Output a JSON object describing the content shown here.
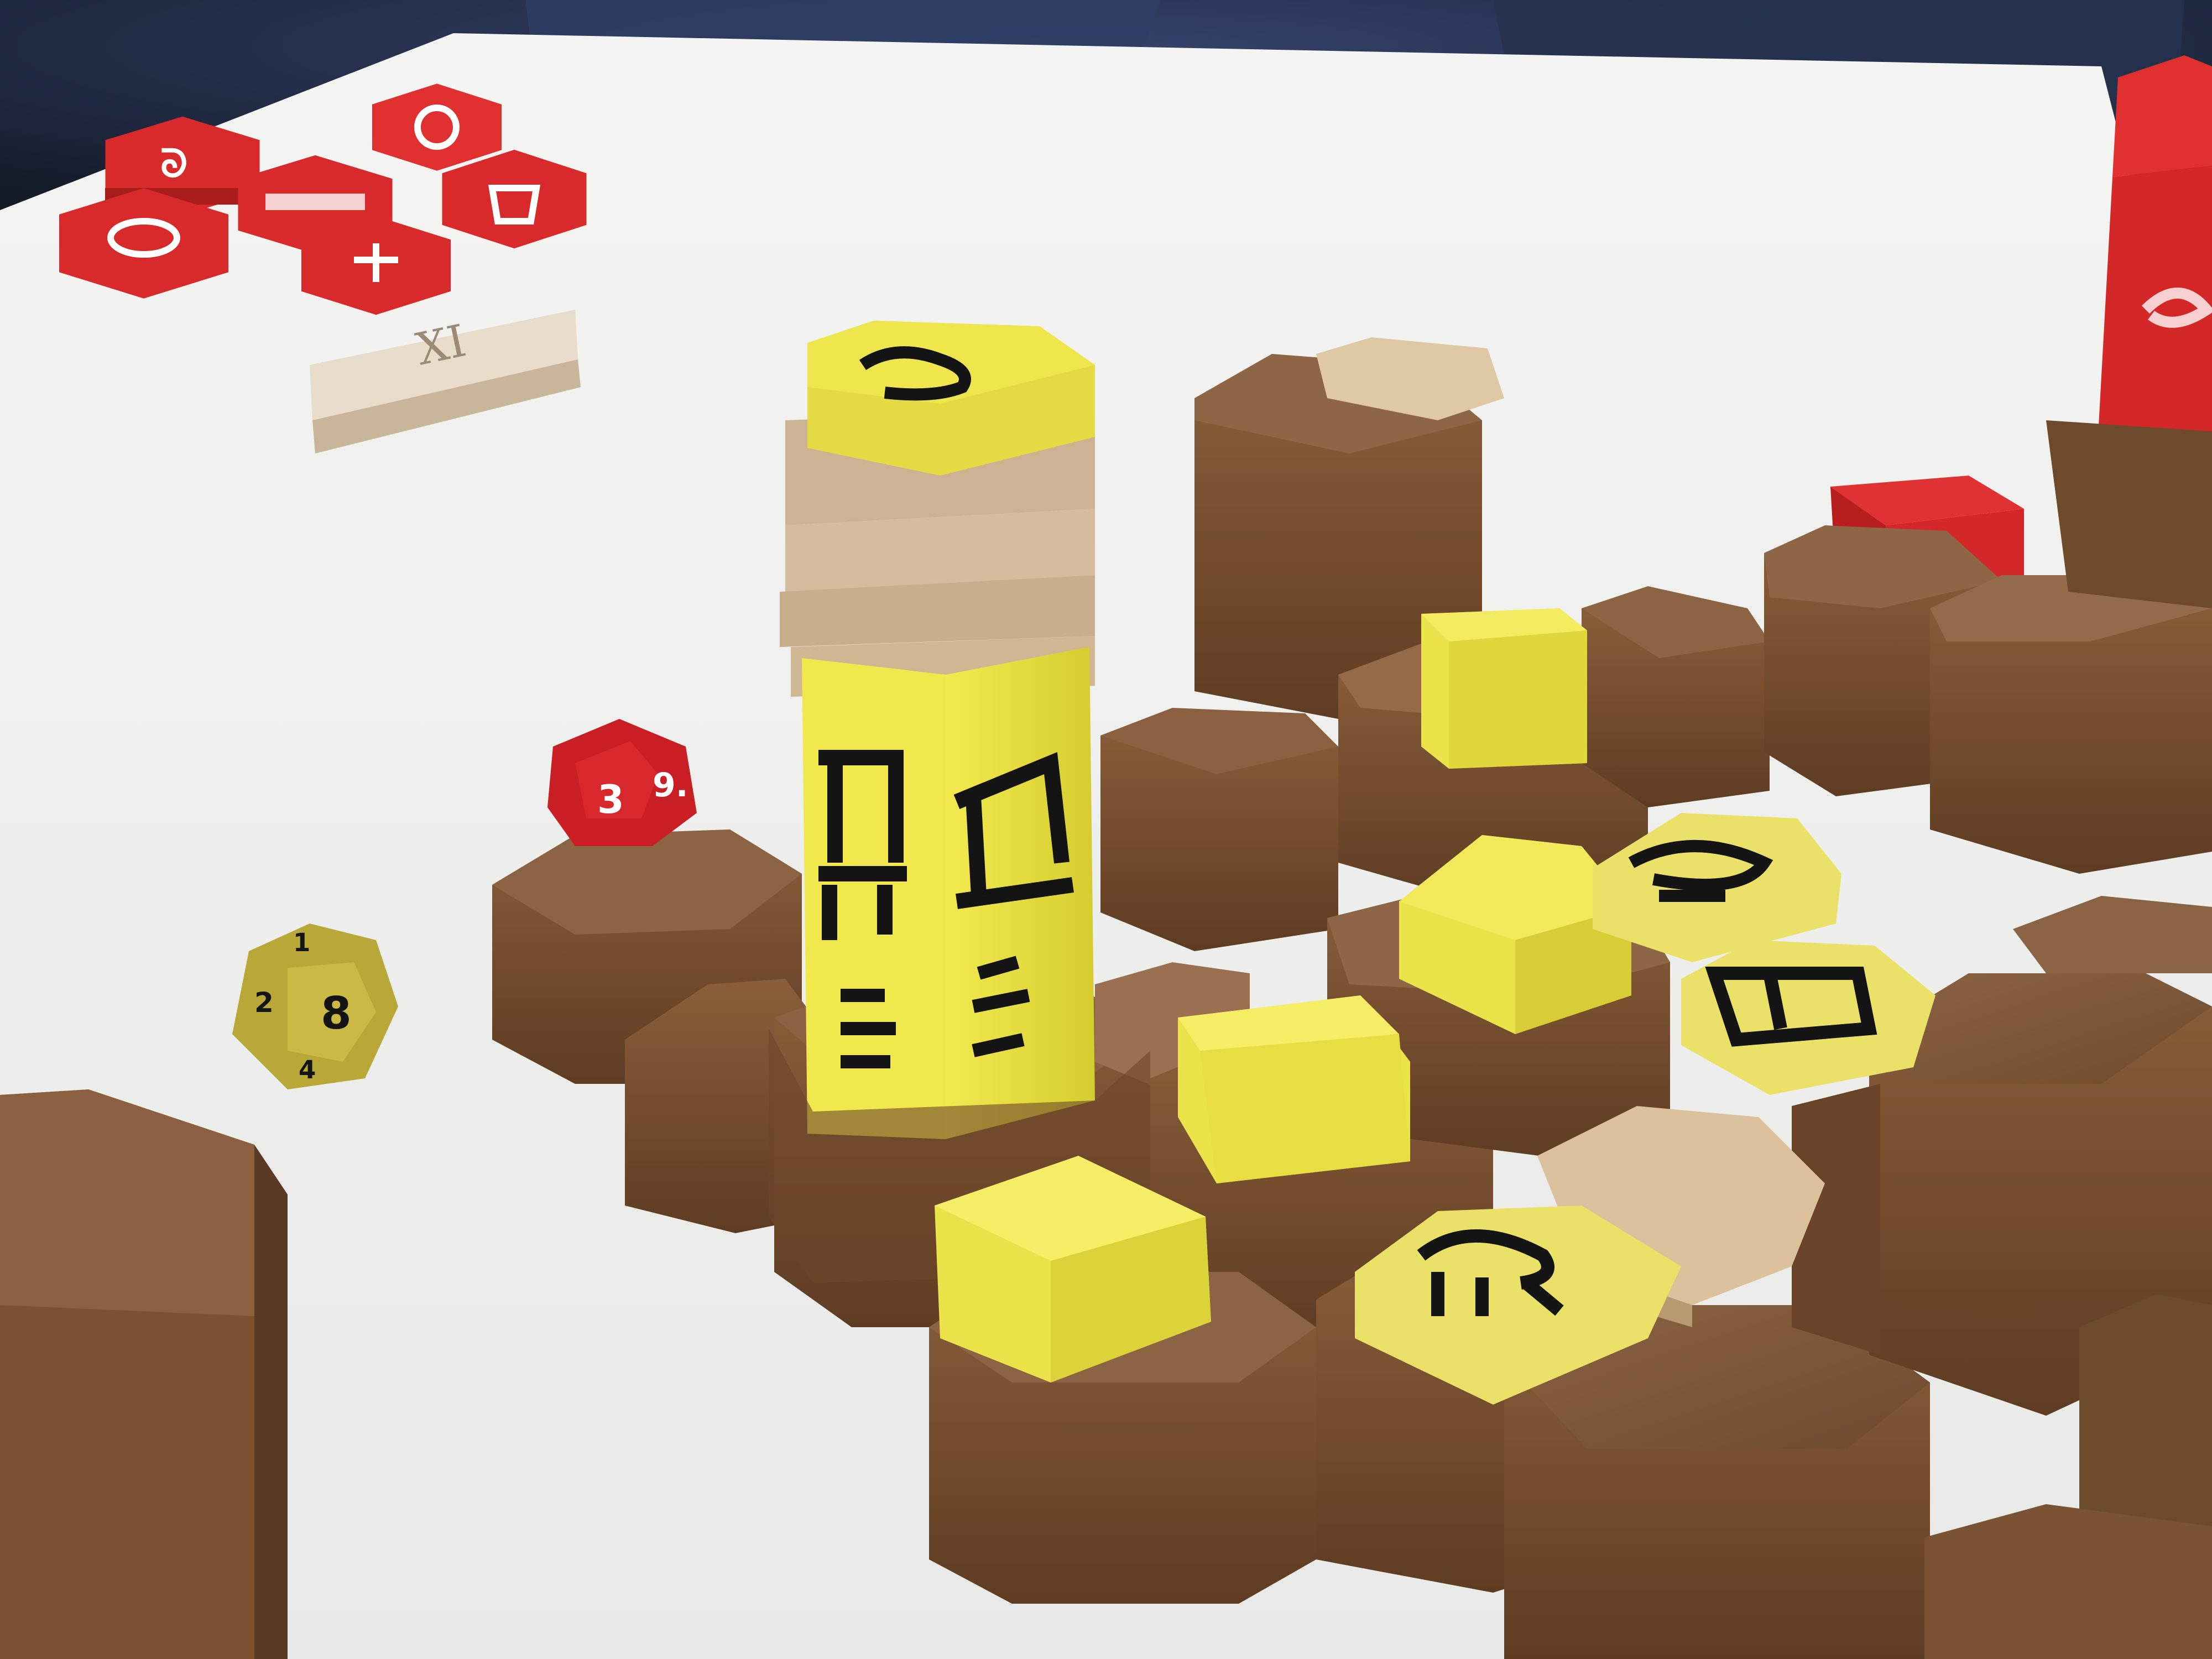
{
  "scene": {
    "description_colors": {
      "table": "#f2f2f0",
      "walnut": "#7a5232",
      "walnut_dark": "#5a3a22",
      "pine": "#d8c09a",
      "yellow_paint": "#efe64a",
      "red_paint": "#d82a2a",
      "ink": "#141414",
      "background_fabric": "#27324a"
    }
  },
  "dice": {
    "red_die": {
      "visible_numbers": [
        "3",
        "9."
      ],
      "color": "#c81e24"
    },
    "yellow_die": {
      "visible_numbers": [
        "1",
        "2",
        "8",
        "4"
      ],
      "color": "#b9a838"
    }
  },
  "pieces": {
    "roman_tile_text": "XI"
  }
}
